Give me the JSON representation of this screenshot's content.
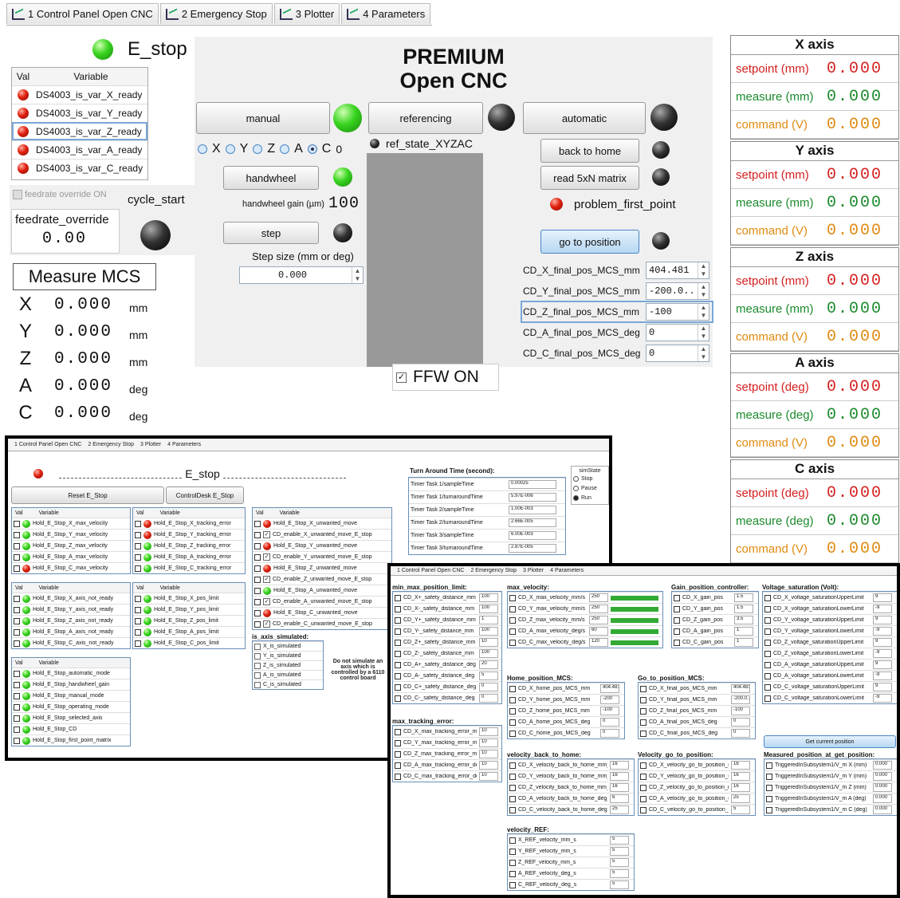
{
  "tabs": [
    "1 Control Panel Open CNC",
    "2 Emergency Stop",
    "3 Plotter",
    "4 Parameters"
  ],
  "estop": {
    "label": "E_stop",
    "color": "#37d41f"
  },
  "var_table": {
    "col_val": "Val",
    "col_var": "Variable",
    "rows": [
      "DS4003_is_var_X_ready",
      "DS4003_is_var_Y_ready",
      "DS4003_is_var_Z_ready",
      "DS4003_is_var_A_ready",
      "DS4003_is_var_C_ready"
    ]
  },
  "feedrate": {
    "checkbox": "feedrate override ON",
    "label": "feedrate_override",
    "value": "0.00",
    "cycle_start": "cycle_start"
  },
  "title": {
    "line1": "PREMIUM",
    "line2": "Open CNC"
  },
  "controls": {
    "manual": "manual",
    "referencing": "referencing",
    "automatic": "automatic",
    "handwheel": "handwheel",
    "hw_gain_label": "handwheel gain (µm)",
    "hw_gain_value": "100",
    "step": "step",
    "step_size_label": "Step size (mm or deg)",
    "step_size_value": "0.000",
    "ref_state": "ref_state_XYZAC",
    "axes": [
      "X",
      "Y",
      "Z",
      "A",
      "C"
    ],
    "radio_value": "0",
    "back_home": "back to home",
    "read_matrix": "read 5xN matrix",
    "problem": "problem_first_point",
    "go_pos": "go to position",
    "ffw": "FFW ON"
  },
  "final_pos": [
    {
      "label": "CD_X_final_pos_MCS_mm",
      "value": "404.481"
    },
    {
      "label": "CD_Y_final_pos_MCS_mm",
      "value": "-200.0..."
    },
    {
      "label": "CD_Z_final_pos_MCS_mm",
      "value": "-100"
    },
    {
      "label": "CD_A_final_pos_MCS_deg",
      "value": "0"
    },
    {
      "label": "CD_C_final_pos_MCS_deg",
      "value": "0"
    }
  ],
  "mcs": {
    "title": "Measure MCS",
    "rows": [
      {
        "axis": "X",
        "value": "0.000",
        "unit": "mm"
      },
      {
        "axis": "Y",
        "value": "0.000",
        "unit": "mm"
      },
      {
        "axis": "Z",
        "value": "0.000",
        "unit": "mm"
      },
      {
        "axis": "A",
        "value": "0.000",
        "unit": "deg"
      },
      {
        "axis": "C",
        "value": "0.000",
        "unit": "deg"
      }
    ]
  },
  "axes_panel": [
    {
      "name": "X axis",
      "setpoint": "setpoint (mm)",
      "measure": "measure (mm)",
      "command": "command (V)",
      "v": "0.000"
    },
    {
      "name": "Y axis",
      "setpoint": "setpoint (mm)",
      "measure": "measure (mm)",
      "command": "command (V)",
      "v": "0.000"
    },
    {
      "name": "Z axis",
      "setpoint": "setpoint (mm)",
      "measure": "measure (mm)",
      "command": "command (V)",
      "v": "0.000"
    },
    {
      "name": "A axis",
      "setpoint": "setpoint (deg)",
      "measure": "measure (deg)",
      "command": "command (V)",
      "v": "0.000"
    },
    {
      "name": "C axis",
      "setpoint": "setpoint (deg)",
      "measure": "measure (deg)",
      "command": "command (V)",
      "v": "0.000"
    }
  ],
  "shot1": {
    "estop_title": "E_stop",
    "reset": "Reset E_Stop",
    "cdesk": "ControlDesk E_Stop",
    "tat_title": "Turn Around Time (second):",
    "sim_title": "simState",
    "sim_opts": [
      "Stop",
      "Pause",
      "Run"
    ],
    "t1": [
      "Hold_E_Stop_X_max_velocity",
      "Hold_E_Stop_Y_max_velocity",
      "Hold_E_Stop_Z_max_velocity",
      "Hold_E_Stop_A_max_velocity",
      "Hold_E_Stop_C_max_velocity"
    ],
    "t2": [
      "Hold_E_Stop_X_tracking_error",
      "Hold_E_Stop_Y_tracking_error",
      "Hold_E_Stop_Z_tracking_error",
      "Hold_E_Stop_A_tracking_error",
      "Hold_E_Stop_C_tracking_error"
    ],
    "t3": [
      "Hold_E_Stop_X_axis_not_ready",
      "Hold_E_Stop_Y_axis_not_ready",
      "Hold_E_Stop_Z_axis_not_ready",
      "Hold_E_Stop_A_axis_not_ready",
      "Hold_E_Stop_C_axis_not_ready"
    ],
    "t4": [
      "Hold_E_Stop_X_pos_limit",
      "Hold_E_Stop_Y_pos_limit",
      "Hold_E_Stop_Z_pos_limit",
      "Hold_E_Stop_A_pos_limit",
      "Hold_E_Stop_C_pos_limit"
    ],
    "t5": [
      "Hold_E_Stop_automatic_mode",
      "Hold_E_Stop_handwheel_gain",
      "Hold_E_Stop_manual_mode",
      "Hold_E_Stop_operating_mode",
      "Hold_E_Stop_selected_axis",
      "Hold_E_Stop_CD",
      "Hold_E_Stop_first_point_matrix"
    ],
    "t6": [
      "Hold_E_Stop_X_unwanted_move",
      "CD_enable_X_unwanted_move_E_stop",
      "Hold_E_Stop_Y_unwanted_move",
      "CD_enable_Y_unwanted_move_E_stop",
      "Hold_E_Stop_Z_unwanted_move",
      "CD_enable_Z_unwanted_move_E_stop",
      "Hold_E_Stop_A_unwanted_move",
      "CD_enable_A_unwanted_move_E_stop",
      "Hold_E_Stop_C_unwanted_move",
      "CD_enable_C_unwanted_move_E_stop"
    ],
    "tat": [
      {
        "n": "Timer Task 1/sampleTime",
        "v": "0.00025"
      },
      {
        "n": "Timer Task 1/turnaroundTime",
        "v": "5.97E-006"
      },
      {
        "n": "Timer Task 2/sampleTime",
        "v": "1.00E-003"
      },
      {
        "n": "Timer Task 2/turnaroundTime",
        "v": "2.66E-005"
      },
      {
        "n": "Timer Task 3/sampleTime",
        "v": "6.00E-003"
      },
      {
        "n": "Timer Task 3/turnaroundTime",
        "v": "2.87E-005"
      }
    ],
    "sim_axis_title": "is_axis_simulated:",
    "sim_axis": [
      "X_is_simulated",
      "Y_is_simulated",
      "Z_is_simulated",
      "A_is_simulated",
      "C_is_simulated"
    ],
    "note": "Do not simulate an axis which is controlled by a 6110 control board"
  },
  "shot2": {
    "minmax_title": "min_max_position_limit:",
    "minmax": [
      {
        "n": "CD_X+_safety_distance_mm",
        "v": "100"
      },
      {
        "n": "CD_X-_safety_distance_mm",
        "v": "100"
      },
      {
        "n": "CD_Y+_safety_distance_mm",
        "v": "1"
      },
      {
        "n": "CD_Y-_safety_distance_mm",
        "v": "100"
      },
      {
        "n": "CD_Z+_safety_distance_mm",
        "v": "10"
      },
      {
        "n": "CD_Z-_safety_distance_mm",
        "v": "100"
      },
      {
        "n": "CD_A+_safety_distance_deg",
        "v": "20"
      },
      {
        "n": "CD_A-_safety_distance_deg",
        "v": "5"
      },
      {
        "n": "CD_C+_safety_distance_deg",
        "v": "0"
      },
      {
        "n": "CD_C-_safety_distance_deg",
        "v": "0"
      }
    ],
    "track_title": "max_tracking_error:",
    "track": [
      {
        "n": "CD_X_max_tracking_error_mm",
        "v": "10"
      },
      {
        "n": "CD_Y_max_tracking_error_mm",
        "v": "10"
      },
      {
        "n": "CD_Z_max_tracking_error_mm",
        "v": "10"
      },
      {
        "n": "CD_A_max_tracking_error_deg",
        "v": "10"
      },
      {
        "n": "CD_C_max_tracking_error_deg",
        "v": "10"
      }
    ],
    "maxvel_title": "max_velocity:",
    "maxvel": [
      {
        "n": "CD_X_max_velocity_mm/s",
        "v": "250"
      },
      {
        "n": "CD_Y_max_velocity_mm/s",
        "v": "250"
      },
      {
        "n": "CD_Z_max_velocity_mm/s",
        "v": "250"
      },
      {
        "n": "CD_A_max_velocity_deg/s",
        "v": "60"
      },
      {
        "n": "CD_C_max_velocity_deg/s",
        "v": "120"
      }
    ],
    "gain_title": "Gain_position_controller:",
    "gain": [
      {
        "n": "CD_X_gain_pos",
        "v": "1.5"
      },
      {
        "n": "CD_Y_gain_pos",
        "v": "1.5"
      },
      {
        "n": "CD_Z_gain_pos",
        "v": "3.5"
      },
      {
        "n": "CD_A_gain_pos",
        "v": "1"
      },
      {
        "n": "CD_C_gain_pos",
        "v": "1"
      }
    ],
    "volt_title": "Voltage_saturation (Volt):",
    "volt": [
      {
        "n": "CD_X_voltage_saturationUpperLimit",
        "v": "9"
      },
      {
        "n": "CD_X_voltage_saturationLowerLimit",
        "v": "-9"
      },
      {
        "n": "CD_Y_voltage_saturationUpperLimit",
        "v": "9"
      },
      {
        "n": "CD_Y_voltage_saturationLowerLimit",
        "v": "-9"
      },
      {
        "n": "CD_Z_voltage_saturationUpperLimit",
        "v": "9"
      },
      {
        "n": "CD_Z_voltage_saturationLowerLimit",
        "v": "-9"
      },
      {
        "n": "CD_A_voltage_saturationUpperLimit",
        "v": "9"
      },
      {
        "n": "CD_A_voltage_saturationLowerLimit",
        "v": "-9"
      },
      {
        "n": "CD_C_voltage_saturationUpperLimit",
        "v": "9"
      },
      {
        "n": "CD_C_voltage_saturationLowerLimit",
        "v": "-9"
      }
    ],
    "home_title": "Home_position_MCS:",
    "home": [
      {
        "n": "CD_X_home_pos_MCS_mm",
        "v": "404.481"
      },
      {
        "n": "CD_Y_home_pos_MCS_mm",
        "v": "-200"
      },
      {
        "n": "CD_Z_home_pos_MCS_mm",
        "v": "-100"
      },
      {
        "n": "CD_A_home_pos_MCS_deg",
        "v": "0"
      },
      {
        "n": "CD_C_home_pos_MCS_deg",
        "v": "0"
      }
    ],
    "goto_title": "Go_to_position_MCS:",
    "goto": [
      {
        "n": "CD_X_final_pos_MCS_mm",
        "v": "404.481"
      },
      {
        "n": "CD_Y_final_pos_MCS_mm",
        "v": "-200.0..."
      },
      {
        "n": "CD_Z_final_pos_MCS_mm",
        "v": "-100"
      },
      {
        "n": "CD_A_final_pos_MCS_deg",
        "v": "0"
      },
      {
        "n": "CD_C_final_pos_MCS_deg",
        "v": "0"
      }
    ],
    "getpos": "Get current position",
    "vbh_title": "velocity_back_to_home:",
    "vbh": [
      {
        "n": "CD_X_velocity_back_to_home_mm_s",
        "v": "16"
      },
      {
        "n": "CD_Y_velocity_back_to_home_mm_s",
        "v": "16"
      },
      {
        "n": "CD_Z_velocity_back_to_home_mm_s",
        "v": "16"
      },
      {
        "n": "CD_A_velocity_back_to_home_deg_s",
        "v": "6"
      },
      {
        "n": "CD_C_velocity_back_to_home_deg_s",
        "v": "25"
      }
    ],
    "vgo_title": "Velocity_go_to_position:",
    "vgo": [
      {
        "n": "CD_X_velocity_go_to_position_mm_s",
        "v": "16"
      },
      {
        "n": "CD_Y_velocity_go_to_position_mm_s",
        "v": "16"
      },
      {
        "n": "CD_Z_velocity_go_to_position_mm_s",
        "v": "16"
      },
      {
        "n": "CD_A_velocity_go_to_position_deg_s",
        "v": "25"
      },
      {
        "n": "CD_C_velocity_go_to_position_deg_s",
        "v": "5"
      }
    ],
    "meas_title": "Measured_position_at_get_position:",
    "meas": [
      {
        "n": "TriggeredInSubsystem1/V_m X (mm)",
        "v": "0.000"
      },
      {
        "n": "TriggeredInSubsystem1/V_m Y (mm)",
        "v": "0.000"
      },
      {
        "n": "TriggeredInSubsystem1/V_m Z (mm)",
        "v": "0.000"
      },
      {
        "n": "TriggeredInSubsystem1/V_m A (deg)",
        "v": "0.000"
      },
      {
        "n": "TriggeredInSubsystem1/V_m C (deg)",
        "v": "0.000"
      }
    ],
    "vref_title": "velocity_REF:",
    "vref": [
      {
        "n": "X_REF_velocity_mm_s",
        "v": "5"
      },
      {
        "n": "Y_REF_velocity_mm_s",
        "v": "5"
      },
      {
        "n": "Z_REF_velocity_mm_s",
        "v": "5"
      },
      {
        "n": "A_REF_velocity_deg_s",
        "v": "5"
      },
      {
        "n": "C_REF_velocity_deg_s",
        "v": "5"
      }
    ]
  }
}
